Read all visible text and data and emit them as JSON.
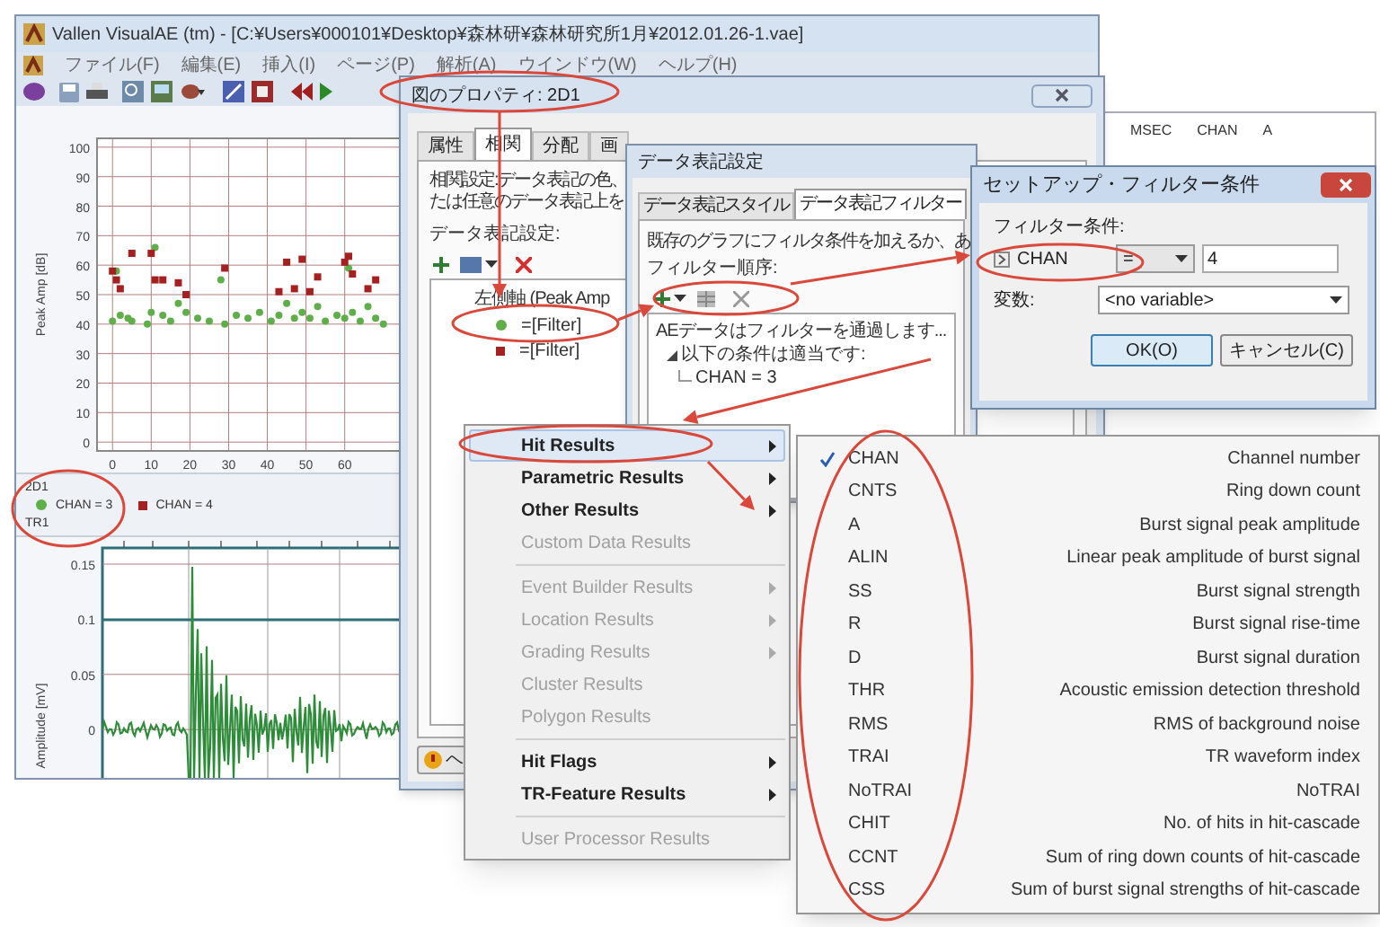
{
  "main_window": {
    "title": "Vallen VisualAE (tm) - [C:¥Users¥000101¥Desktop¥森林研¥森林研究所1月¥2012.01.26-1.vae]",
    "menu": [
      "ファイル(F)",
      "編集(E)",
      "挿入(I)",
      "ページ(P)",
      "解析(A)",
      "ウインドウ(W)",
      "ヘルプ(H)"
    ]
  },
  "listing_header": [
    "MSEC",
    "CHAN",
    "A"
  ],
  "scatter_plot": {
    "chart_data": {
      "type": "scatter",
      "grid": true,
      "ylabel": "Peak Amp [dB]",
      "xlim": [
        -4,
        74
      ],
      "ylim": [
        -3,
        103
      ],
      "xticks": [
        0,
        10,
        20,
        30,
        40,
        50,
        60
      ],
      "yticks": [
        0,
        10,
        20,
        30,
        40,
        50,
        60,
        70,
        80,
        90,
        100
      ],
      "x": [
        0,
        1,
        2,
        4,
        5,
        9,
        10,
        11,
        13,
        15,
        17,
        19,
        22,
        25,
        28,
        29,
        32,
        35,
        38,
        41,
        43,
        45,
        47,
        49,
        51,
        53,
        55,
        58,
        60,
        61,
        62,
        64,
        66,
        68,
        70
      ],
      "series": [
        {
          "name": "CHAN = 3",
          "color": "#5fae4a",
          "values": [
            41,
            58,
            43,
            42,
            41,
            40,
            44,
            66,
            43,
            41,
            47,
            44,
            42,
            41,
            55,
            40,
            43,
            42,
            44,
            41,
            43,
            47,
            42,
            44,
            42,
            46,
            41,
            43,
            42,
            59,
            44,
            41,
            46,
            42,
            40
          ]
        },
        {
          "name": "CHAN = 4",
          "color": "#a52020",
          "values": [
            58,
            55,
            52,
            null,
            64,
            null,
            64,
            55,
            55,
            null,
            54,
            50,
            null,
            null,
            null,
            59,
            null,
            null,
            null,
            null,
            51,
            61,
            52,
            62,
            51,
            56,
            null,
            null,
            61,
            63,
            57,
            null,
            52,
            55,
            null
          ]
        }
      ]
    },
    "plot_label": "2D1"
  },
  "waveform_plot": {
    "plot_label": "TR1",
    "ylabel": "Amplitude [mV]",
    "yticks": [
      "0.15",
      "0.1",
      "0.05",
      "0"
    ]
  },
  "properties_dialog": {
    "title": "図のプロパティ: 2D1",
    "tabs": [
      {
        "label": "属性",
        "selected": false
      },
      {
        "label": "相関",
        "selected": true
      },
      {
        "label": "分配",
        "selected": false
      },
      {
        "label": "画",
        "selected": false
      }
    ],
    "description": [
      "相関設定:データ表記の色、",
      "たは任意のデータ表記上を"
    ],
    "section_label": "データ表記設定:",
    "tree": {
      "label": "左側軸 (Peak Amp",
      "children": [
        {
          "label": "=[Filter]",
          "color": "#5fae4a",
          "kind": "circle"
        },
        {
          "label": "=[Filter]",
          "color": "#a52020",
          "kind": "square"
        }
      ]
    },
    "help_button": "ヘ"
  },
  "series_dialog": {
    "title": "データ表記設定",
    "tabs": [
      {
        "label": "データ表記スタイル",
        "selected": false
      },
      {
        "label": "データ表記フィルター",
        "selected": true
      }
    ],
    "description": "既存のグラフにフィルタ条件を加えるか、あ",
    "order_label": "フィルター順序:",
    "tree": {
      "label": "AEデータはフィルターを通過します...",
      "children": [
        {
          "label": "以下の条件は適当です:",
          "expanded": true,
          "children": [
            {
              "label": "CHAN = 3"
            }
          ]
        }
      ]
    }
  },
  "filter_dialog": {
    "title": "セットアップ・フィルター条件",
    "condition_label": "フィルター条件:",
    "field": "CHAN",
    "operator": "=",
    "value": "4",
    "variable_label": "変数:",
    "variable": "<no variable>",
    "buttons": [
      "OK(O)",
      "キャンセル(C)"
    ]
  },
  "context_menu": [
    {
      "kind": "item",
      "label": "Hit Results",
      "submenu": true,
      "disabled": false,
      "selected": true
    },
    {
      "kind": "item",
      "label": "Parametric Results",
      "submenu": true,
      "disabled": false,
      "selected": false
    },
    {
      "kind": "item",
      "label": "Other Results",
      "submenu": true,
      "disabled": false,
      "selected": false
    },
    {
      "kind": "item",
      "label": "Custom Data Results",
      "submenu": false,
      "disabled": true,
      "selected": false
    },
    {
      "kind": "separator"
    },
    {
      "kind": "item",
      "label": "Event Builder Results",
      "submenu": true,
      "disabled": true,
      "selected": false
    },
    {
      "kind": "item",
      "label": "Location Results",
      "submenu": true,
      "disabled": true,
      "selected": false
    },
    {
      "kind": "item",
      "label": "Grading Results",
      "submenu": true,
      "disabled": true,
      "selected": false
    },
    {
      "kind": "item",
      "label": "Cluster Results",
      "submenu": false,
      "disabled": true,
      "selected": false
    },
    {
      "kind": "item",
      "label": "Polygon Results",
      "submenu": false,
      "disabled": true,
      "selected": false
    },
    {
      "kind": "separator"
    },
    {
      "kind": "item",
      "label": "Hit Flags",
      "submenu": true,
      "disabled": false,
      "selected": false
    },
    {
      "kind": "item",
      "label": "TR-Feature Results",
      "submenu": true,
      "disabled": false,
      "selected": false
    },
    {
      "kind": "separator"
    },
    {
      "kind": "item",
      "label": "User Processor Results",
      "submenu": false,
      "disabled": true,
      "selected": false
    }
  ],
  "submenu": [
    {
      "code": "CHAN",
      "description": "Channel number",
      "checked": true
    },
    {
      "code": "CNTS",
      "description": "Ring down count",
      "checked": false
    },
    {
      "code": "A",
      "description": "Burst signal peak amplitude",
      "checked": false
    },
    {
      "code": "ALIN",
      "description": "Linear peak amplitude of burst signal",
      "checked": false
    },
    {
      "code": "SS",
      "description": "Burst signal strength",
      "checked": false
    },
    {
      "code": "R",
      "description": "Burst signal rise-time",
      "checked": false
    },
    {
      "code": "D",
      "description": "Burst signal duration",
      "checked": false
    },
    {
      "code": "THR",
      "description": "Acoustic emission detection threshold",
      "checked": false
    },
    {
      "code": "RMS",
      "description": "RMS of background noise",
      "checked": false
    },
    {
      "code": "TRAI",
      "description": "TR waveform index",
      "checked": false
    },
    {
      "code": "NoTRAI",
      "description": "NoTRAI",
      "checked": false
    },
    {
      "code": "CHIT",
      "description": "No. of hits in hit-cascade",
      "checked": false
    },
    {
      "code": "CCNT",
      "description": "Sum of ring down counts of hit-cascade",
      "checked": false
    },
    {
      "code": "CSS",
      "description": "Sum of burst signal strengths of hit-cascade",
      "checked": false
    }
  ]
}
